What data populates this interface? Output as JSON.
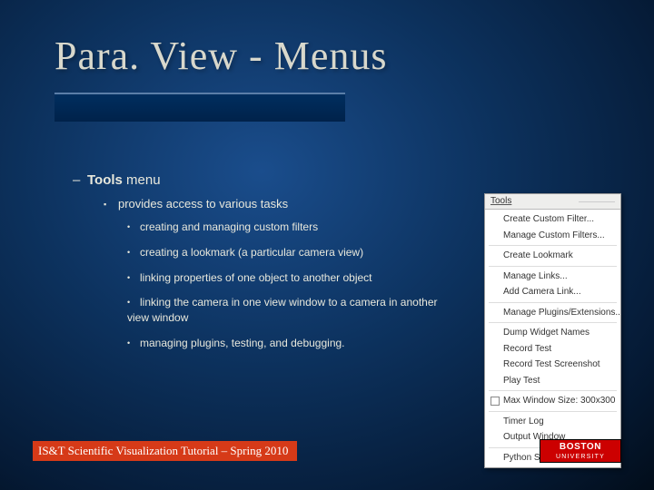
{
  "title": "Para. View - Menus",
  "bullet_lvl1_prefix": "– ",
  "bullet_lvl1_bold": "Tools",
  "bullet_lvl1_rest": " menu",
  "bullet_lvl2": "provides access to various tasks",
  "bullets_lvl3": [
    "creating and managing custom filters",
    "creating a lookmark (a particular camera view)",
    "linking properties of one object to another object",
    "linking the camera in one view window to a camera in another view window",
    "managing plugins, testing, and debugging."
  ],
  "footer": "IS&T Scientific Visualization Tutorial – Spring 2010",
  "logo": {
    "line1": "BOSTON",
    "line2": "UNIVERSITY"
  },
  "menu": {
    "header": "Tools",
    "groups": [
      [
        "Create Custom Filter...",
        "Manage Custom Filters..."
      ],
      [
        "Create Lookmark"
      ],
      [
        "Manage Links...",
        "Add Camera Link..."
      ],
      [
        "Manage Plugins/Extensions..."
      ],
      [
        "Dump Widget Names",
        "Record Test",
        "Record Test Screenshot",
        "Play Test"
      ],
      [
        {
          "type": "check",
          "label": "Max Window Size: 300x300"
        }
      ],
      [
        "Timer Log",
        "Output Window"
      ],
      [
        "Python Shell"
      ]
    ]
  }
}
